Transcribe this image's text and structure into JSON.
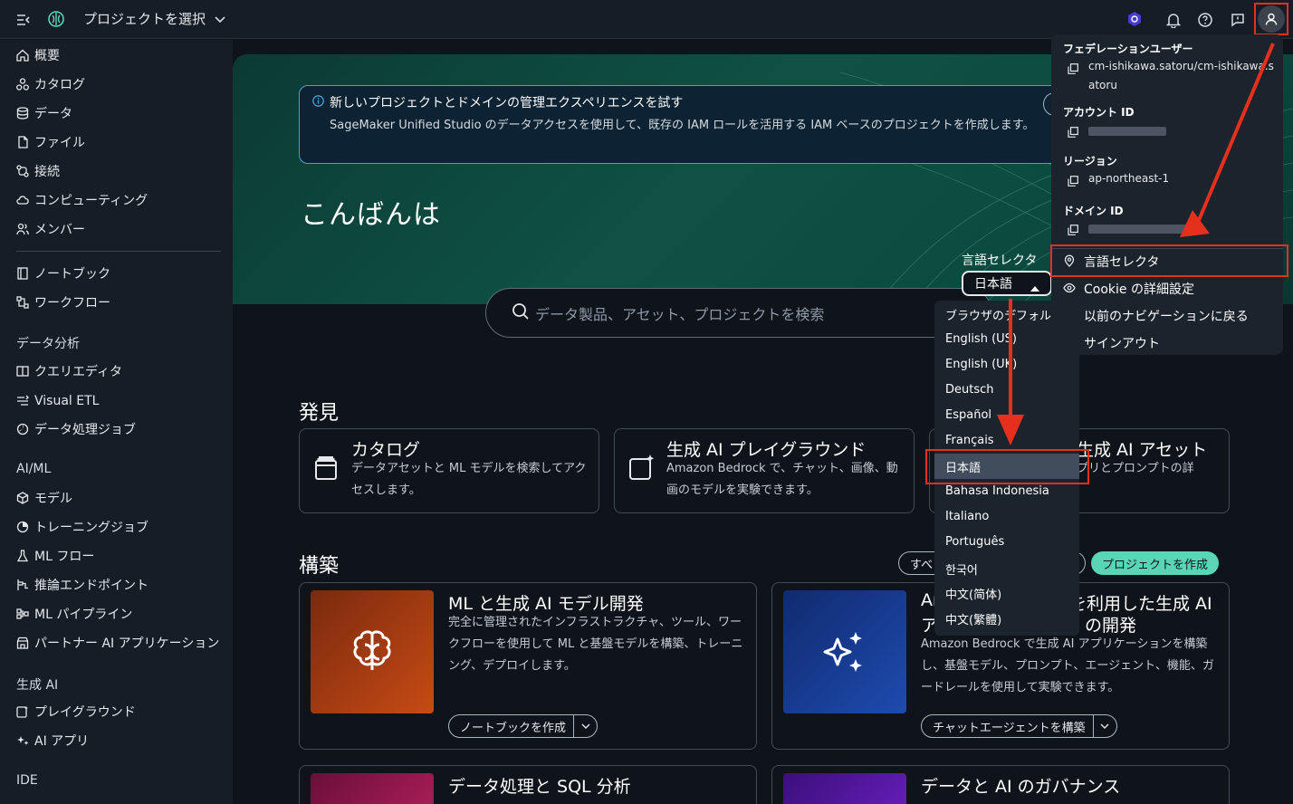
{
  "topbar": {
    "project_select": "プロジェクトを選択"
  },
  "sidebar": {
    "group1": [
      "概要",
      "カタログ",
      "データ",
      "ファイル",
      "接続",
      "コンピューティング",
      "メンバー"
    ],
    "group2": [
      "ノートブック",
      "ワークフロー"
    ],
    "section_data_analysis": "データ分析",
    "group3": [
      "クエリエディタ",
      "Visual ETL",
      "データ処理ジョブ"
    ],
    "section_aiml": "AI/ML",
    "group4": [
      "モデル",
      "トレーニングジョブ",
      "ML フロー",
      "推論エンドポイント",
      "ML パイプライン",
      "パートナー AI アプリケーション"
    ],
    "section_genai": "生成 AI",
    "group5": [
      "プレイグラウンド",
      "AI アプリ"
    ],
    "section_ide": "IDE"
  },
  "banner": {
    "title": "新しいプロジェクトとドメインの管理エクスペリエンスを試す",
    "body": "SageMaker Unified Studio のデータアクセスを使用して、既存の IAM ロールを活用する IAM ベースのプロジェクトを作成します。"
  },
  "greeting": "こんばんは",
  "search": {
    "placeholder": "データ製品、アセット、プロジェクトを検索"
  },
  "discover": {
    "title": "発見",
    "cards": [
      {
        "title": "カタログ",
        "desc": "データアセットと ML モデルを検索してアクセスします。"
      },
      {
        "title": "生成 AI プレイグラウンド",
        "desc": "Amazon Bedrock で、チャット、画像、動画のモデルを実験できます。"
      },
      {
        "title": "生成 AI アセット",
        "desc": "プリとプロンプトの詳"
      }
    ]
  },
  "build": {
    "title": "構築",
    "filter_partial": "すべ",
    "create_project": "プロジェクトを作成",
    "cards": [
      {
        "title": "ML と生成 AI モデル開発",
        "desc": "完全に管理されたインフラストラクチャ、ツール、ワークフローを使用して ML と基盤モデルを構築、トレーニング、デプロイします。",
        "button": "ノートブックを作成"
      },
      {
        "title_line1": "Am",
        "title_line1b": "を利用した生成 AI",
        "title_line2": "ア",
        "title_line2b": "の開発",
        "desc": "Amazon Bedrock で生成 AI アプリケーションを構築し、基盤モデル、プロンプト、エージェント、機能、ガードレールを使用して実験できます。",
        "button": "チャットエージェントを構築"
      },
      {
        "title": "データ処理と SQL 分析"
      },
      {
        "title": "データと AI のガバナンス"
      }
    ]
  },
  "language": {
    "label": "言語セレクタ",
    "selected": "日本語",
    "options": [
      "ブラウザのデフォルト",
      "English (US)",
      "English (UK)",
      "Deutsch",
      "Español",
      "Français",
      "日本語",
      "Bahasa Indonesia",
      "Italiano",
      "Português",
      "한국어",
      "中文(简体)",
      "中文(繁體)"
    ]
  },
  "user_menu": {
    "federation_user_label": "フェデレーションユーザー",
    "federation_user_value": "cm-ishikawa.satoru/cm-ishikawa.satoru",
    "account_id_label": "アカウント ID",
    "region_label": "リージョン",
    "region_value": "ap-northeast-1",
    "domain_id_label": "ドメイン ID",
    "items": [
      "言語セレクタ",
      "Cookie の詳細設定",
      "以前のナビゲーションに戻る",
      "サインアウト"
    ]
  },
  "colors": {
    "accent": "#5ad6b5",
    "highlight": "#e5301e",
    "info_border": "#3fa3d8"
  }
}
